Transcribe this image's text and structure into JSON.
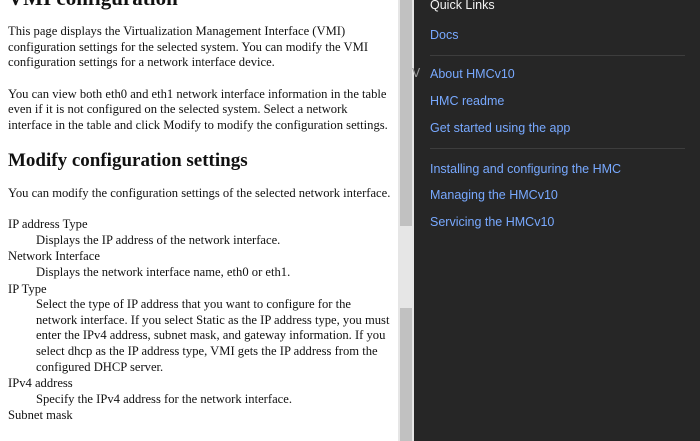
{
  "doc": {
    "title": "VMI configuration",
    "intro1": "This page displays the Virtualization Management Interface (VMI) configuration settings for the selected system. You can modify the VMI configuration settings for a network interface device.",
    "intro2": "You can view both eth0 and eth1 network interface information in the table even if it is not configured on the selected system. Select a network interface in the table and click Modify to modify the configuration settings.",
    "heading": "Modify configuration settings",
    "modify_text": "You can modify the configuration settings of the selected network interface.",
    "terms": [
      {
        "term": "IP address Type",
        "desc": "Displays the IP address of the network interface."
      },
      {
        "term": "Network Interface",
        "desc": "Displays the network interface name, eth0 or eth1."
      },
      {
        "term": "IP Type",
        "desc": "Select the type of IP address that you want to configure for the network interface. If you select Static as the IP address type, you must enter the IPv4 address, subnet mask, and gateway information. If you select dhcp as the IP address type, VMI gets the IP address from the configured DHCP server."
      },
      {
        "term": "IPv4 address",
        "desc": "Specify the IPv4 address for the network interface."
      },
      {
        "term": "Subnet mask",
        "desc": ""
      }
    ]
  },
  "panel": {
    "title": "Quick Links",
    "docs": "Docs",
    "group1": [
      "About HMCv10",
      "HMC readme",
      "Get started using the app"
    ],
    "group2": [
      "Installing and configuring the HMC",
      "Managing the HMCv10",
      "Servicing the HMCv10"
    ]
  },
  "gutter_glyph": "V",
  "colors": {
    "panel_bg": "#262626",
    "link": "#78a9ff",
    "panel_text": "#f4f4f4"
  }
}
